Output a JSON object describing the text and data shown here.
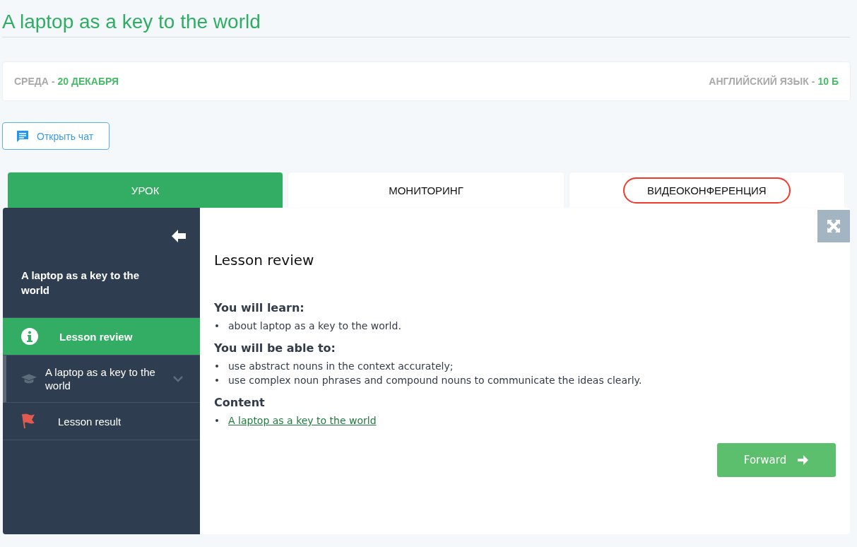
{
  "page_title": "A laptop as a key to the world",
  "info_bar": {
    "day": "СРЕДА",
    "separator": "-",
    "date": "20 ДЕКАБРЯ",
    "subject": "АНГЛИЙСКИЙ ЯЗЫК",
    "subject_separator": "-",
    "class": "10 Б"
  },
  "chat_button": {
    "label": "Открыть чат"
  },
  "tabs": [
    {
      "label": "УРОК",
      "selected": true,
      "highlighted": false
    },
    {
      "label": "МОНИТОРИНГ",
      "selected": false,
      "highlighted": false
    },
    {
      "label": "ВИДЕОКОНФЕРЕНЦИЯ",
      "selected": false,
      "highlighted": true
    }
  ],
  "sidebar": {
    "title": "A laptop as a key to the world",
    "items": [
      {
        "kind": "info",
        "label": "Lesson review",
        "selected": true,
        "expandable": false
      },
      {
        "kind": "course",
        "label": "A laptop as a key to the world",
        "selected": false,
        "expandable": true
      },
      {
        "kind": "result",
        "label": "Lesson result",
        "selected": false,
        "expandable": false
      }
    ]
  },
  "content": {
    "title": "Lesson review",
    "sections": [
      {
        "heading": "You will learn:",
        "items": [
          {
            "kind": "text",
            "text": "about laptop as a key to the world."
          }
        ]
      },
      {
        "heading": "You will be able to:",
        "items": [
          {
            "kind": "text",
            "text": "use abstract nouns in the context accurately;"
          },
          {
            "kind": "text",
            "text": "use complex noun phrases and compound nouns to communicate the ideas clearly."
          }
        ]
      },
      {
        "heading": "Content",
        "items": [
          {
            "kind": "link",
            "text": "A laptop as a key to the world"
          }
        ]
      }
    ],
    "forward_button": {
      "label": "Forward"
    }
  }
}
